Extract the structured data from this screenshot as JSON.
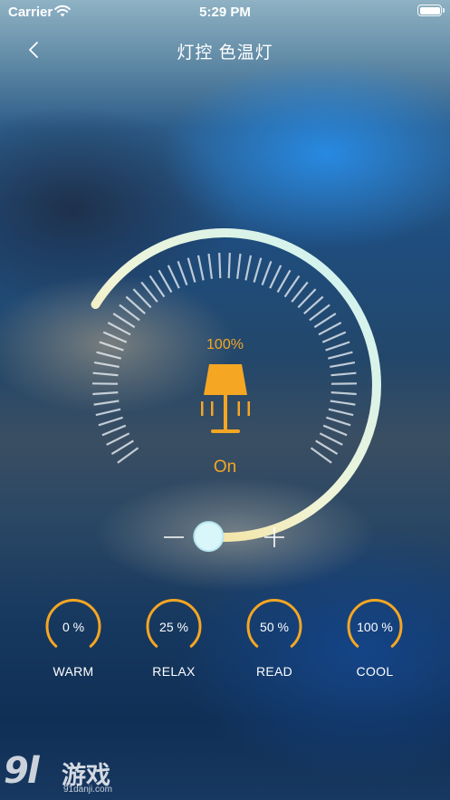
{
  "status_bar": {
    "carrier": "Carrier",
    "time": "5:29 PM"
  },
  "nav": {
    "title": "灯控 色温灯"
  },
  "dial": {
    "brightness_label": "100%",
    "brightness_value": 1.0,
    "state_label": "On",
    "lamp_color": "#f5a623"
  },
  "controls": {
    "decrease_icon": "minus-icon",
    "increase_icon": "plus-icon"
  },
  "presets": [
    {
      "value_label": "0 %",
      "name": "WARM"
    },
    {
      "value_label": "25 %",
      "name": "RELAX"
    },
    {
      "value_label": "50 %",
      "name": "READ"
    },
    {
      "value_label": "100 %",
      "name": "COOL"
    }
  ],
  "watermark": {
    "logo": "9l",
    "name": "游戏",
    "url": "91danji.com"
  },
  "colors": {
    "accent": "#f5a623",
    "arc_warm": "#f3d67a",
    "arc_cool": "#c9f2f6"
  }
}
